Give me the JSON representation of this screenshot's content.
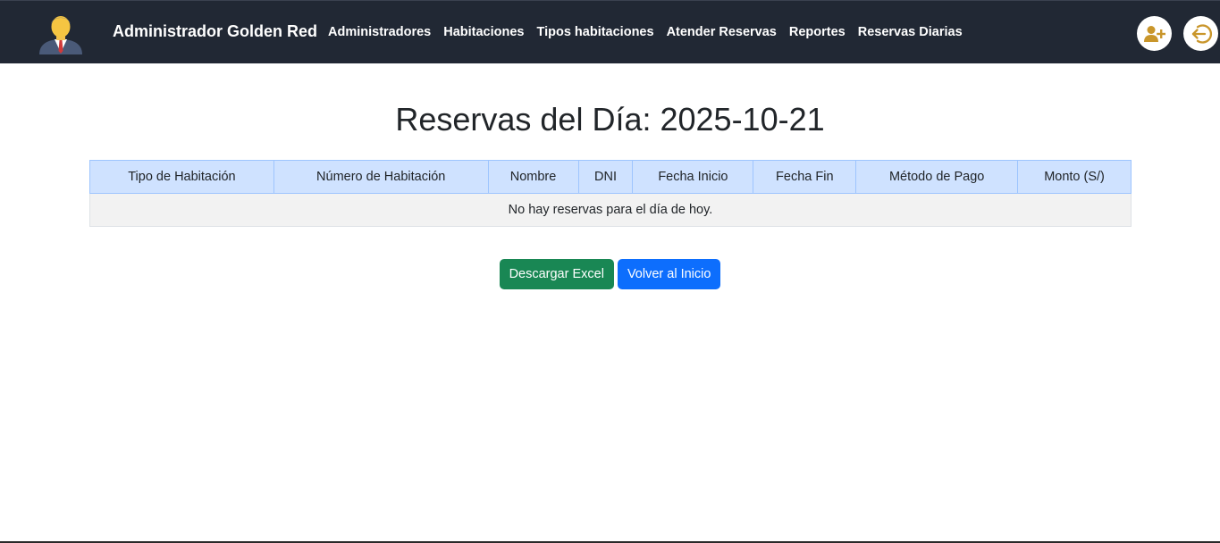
{
  "navbar": {
    "brand": "Administrador Golden Red",
    "links": [
      "Administradores",
      "Habitaciones",
      "Tipos habitaciones",
      "Atender Reservas",
      "Reportes",
      "Reservas Diarias"
    ],
    "avatar_icon": "businessman-avatar-icon",
    "add_user_icon": "add-user-icon",
    "logout_icon": "logout-icon",
    "accent_color": "#c9962b"
  },
  "main": {
    "title": "Reservas del Día: 2025-10-21",
    "table": {
      "headers": [
        "Tipo de Habitación",
        "Número de Habitación",
        "Nombre",
        "DNI",
        "Fecha Inicio",
        "Fecha Fin",
        "Método de Pago",
        "Monto (S/)"
      ],
      "empty_message": "No hay reservas para el día de hoy."
    },
    "buttons": {
      "download_excel": "Descargar Excel",
      "back_home": "Volver al Inicio"
    }
  }
}
